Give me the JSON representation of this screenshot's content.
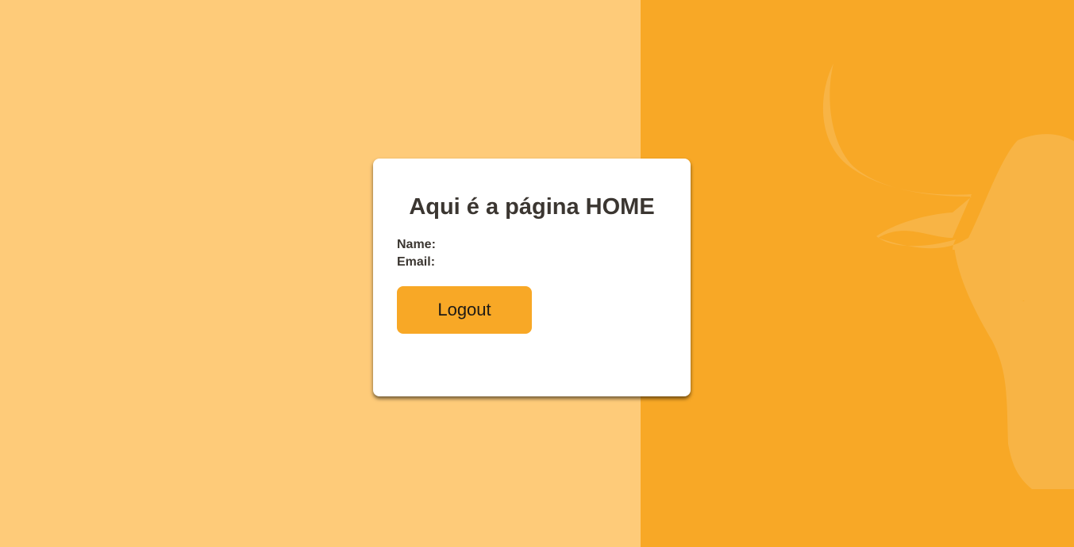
{
  "colors": {
    "left_background": "#fecb79",
    "right_background": "#f8a826",
    "bull_silhouette": "#f8b445",
    "card_background": "#ffffff",
    "button_background": "#f8a826",
    "text": "#3b3631"
  },
  "home": {
    "title": "Aqui é a página HOME",
    "name_label": "Name:",
    "name_value": "",
    "email_label": "Email:",
    "email_value": "",
    "logout_label": "Logout"
  },
  "decoration": {
    "icon": "bull-icon"
  }
}
